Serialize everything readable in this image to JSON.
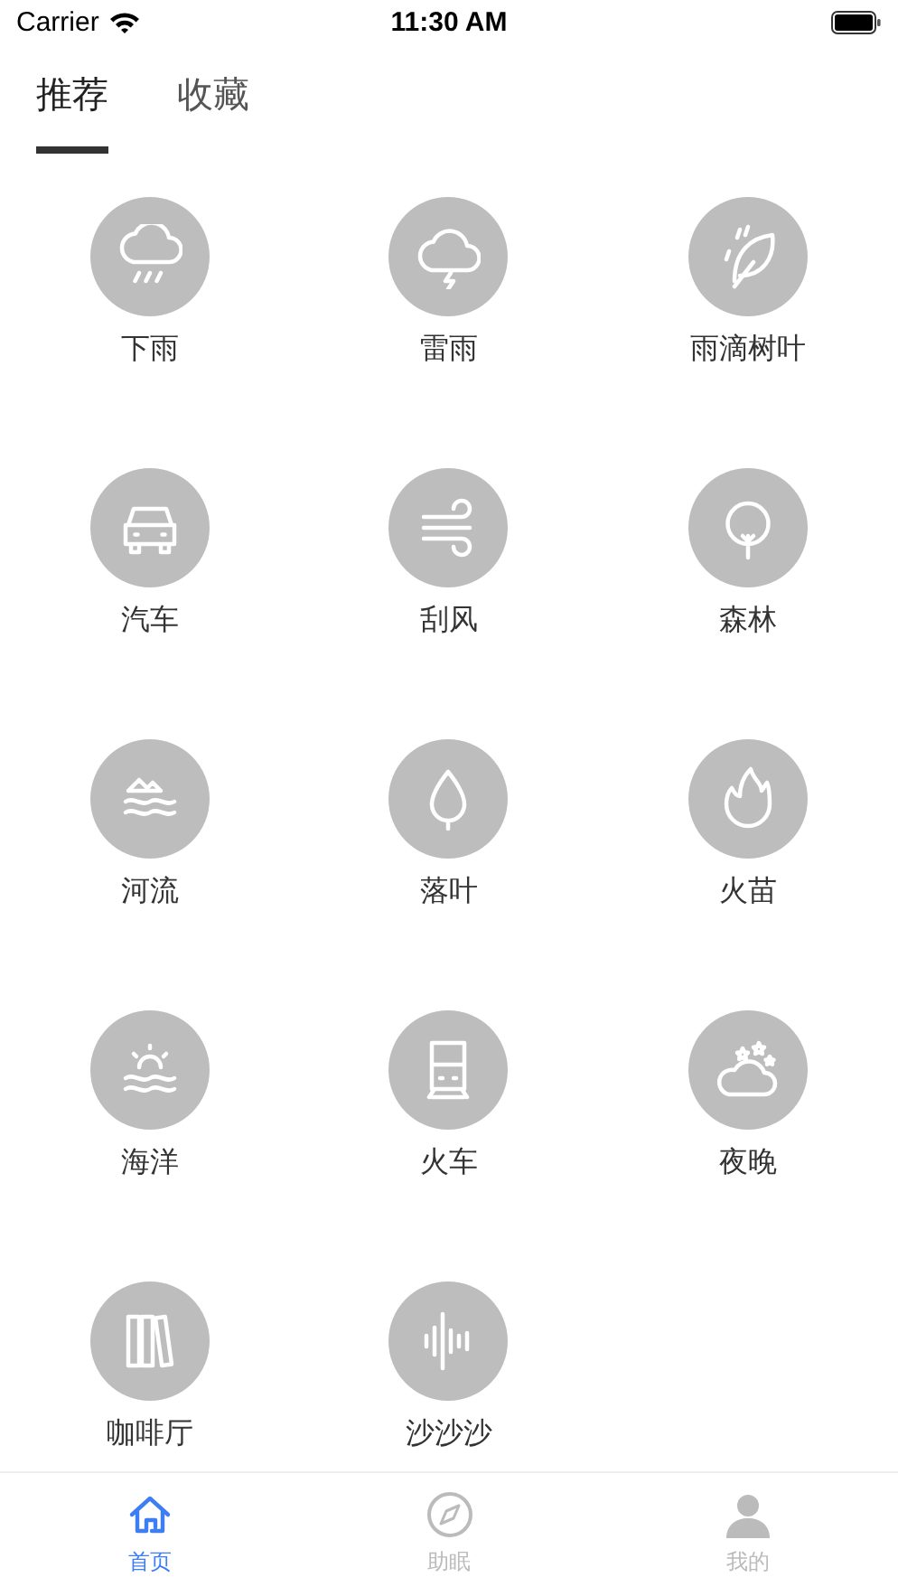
{
  "status_bar": {
    "carrier": "Carrier",
    "time": "11:30 AM"
  },
  "tabs": [
    {
      "label": "推荐",
      "selected": true
    },
    {
      "label": "收藏",
      "selected": false
    }
  ],
  "sounds": [
    {
      "label": "下雨"
    },
    {
      "label": "雷雨"
    },
    {
      "label": "雨滴树叶"
    },
    {
      "label": "汽车"
    },
    {
      "label": "刮风"
    },
    {
      "label": "森林"
    },
    {
      "label": "河流"
    },
    {
      "label": "落叶"
    },
    {
      "label": "火苗"
    },
    {
      "label": "海洋"
    },
    {
      "label": "火车"
    },
    {
      "label": "夜晚"
    },
    {
      "label": "咖啡厅"
    },
    {
      "label": "沙沙沙"
    }
  ],
  "tab_bar": [
    {
      "label": "首页",
      "selected": true
    },
    {
      "label": "助眠",
      "selected": false
    },
    {
      "label": "我的",
      "selected": false
    }
  ]
}
